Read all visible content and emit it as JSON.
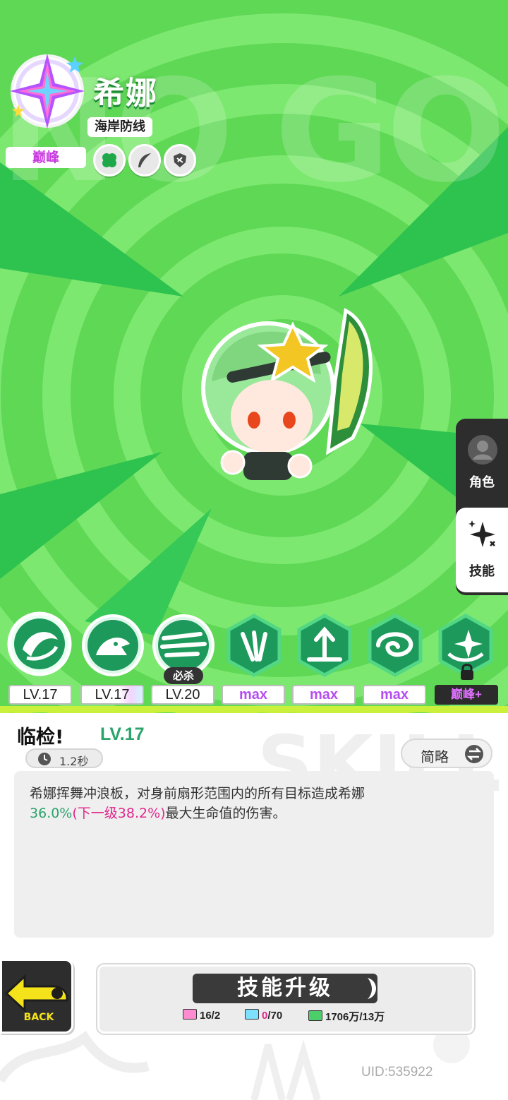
{
  "character": {
    "name": "希娜",
    "team": "海岸防线",
    "rank": "巅峰",
    "class_icons": [
      "clover-icon",
      "feather-icon",
      "shield-claw-icon"
    ]
  },
  "background_word": "NO GOD",
  "side_tabs": [
    {
      "label": "角色",
      "icon": "person-icon",
      "active": false
    },
    {
      "label": "技能",
      "icon": "sparkle-star-icon",
      "active": true
    }
  ],
  "skills": [
    {
      "level": "LV.17",
      "selected": true
    },
    {
      "level": "LV.17",
      "selected": false
    },
    {
      "level": "LV.20",
      "tag": "必杀"
    },
    {
      "level": "max"
    },
    {
      "level": "max"
    },
    {
      "level": "max"
    },
    {
      "level": "巅峰+",
      "locked": true
    }
  ],
  "detail": {
    "title": "临检!",
    "level": "LV.17",
    "cooldown": "1.2秒",
    "brief_label": "简略",
    "desc_line1": "希娜挥舞冲浪板，对身前扇形范围内的所有目标造成希娜",
    "desc_value": "36.0%",
    "desc_next": "(下一级38.2%)",
    "desc_tail": "最大生命值的伤害。",
    "panel_word": "SKILL"
  },
  "upgrade": {
    "label": "技能升级",
    "costs": [
      {
        "icon": "ticket-icon",
        "value": "16/2"
      },
      {
        "icon": "book-icon",
        "current": "0",
        "total": "/70"
      },
      {
        "icon": "cash-icon",
        "value": "1706万/13万"
      }
    ]
  },
  "back_label": "BACK",
  "uid": "UID:535922",
  "colors": {
    "bg_green": "#5fd855",
    "accent_teal": "#2aa46a",
    "max_purple": "#b54df0",
    "highlight_pink": "#e0278a"
  }
}
